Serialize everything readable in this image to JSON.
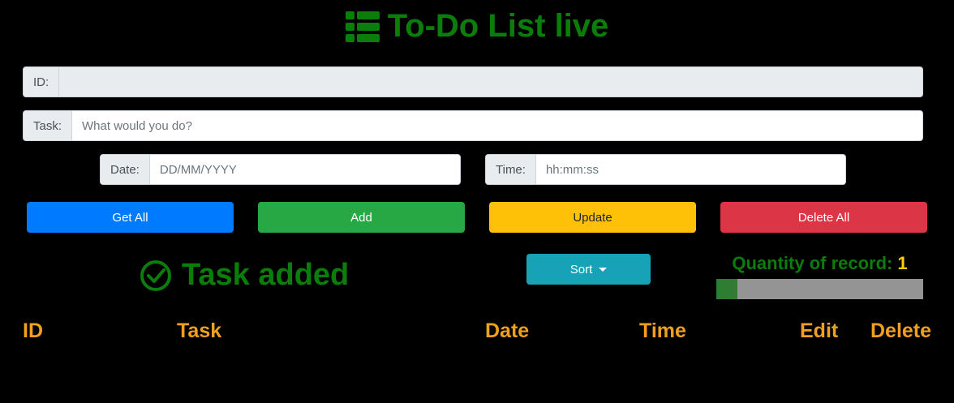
{
  "header": {
    "title": "To-Do List live",
    "icon": "list-icon",
    "color": "#0a7d0a"
  },
  "form": {
    "id_label": "ID:",
    "id_value": "",
    "task_label": "Task:",
    "task_placeholder": "What would you do?",
    "date_label": "Date:",
    "date_placeholder": "DD/MM/YYYY",
    "time_label": "Time:",
    "time_placeholder": "hh:mm:ss"
  },
  "buttons": {
    "get_all": "Get All",
    "add": "Add",
    "update": "Update",
    "delete_all": "Delete All",
    "sort": "Sort"
  },
  "colors": {
    "get_all": "#007bff",
    "add": "#28a745",
    "update": "#ffc107",
    "delete_all": "#dc3545",
    "sort": "#17a2b8"
  },
  "status": {
    "message": "Task added",
    "icon": "check-circle-icon"
  },
  "quantity": {
    "label": "Quantity of record:",
    "value": "1",
    "progress_fraction": 0.1
  },
  "table": {
    "headers": [
      "ID",
      "Task",
      "Date",
      "Time",
      "Edit",
      "Delete"
    ]
  }
}
